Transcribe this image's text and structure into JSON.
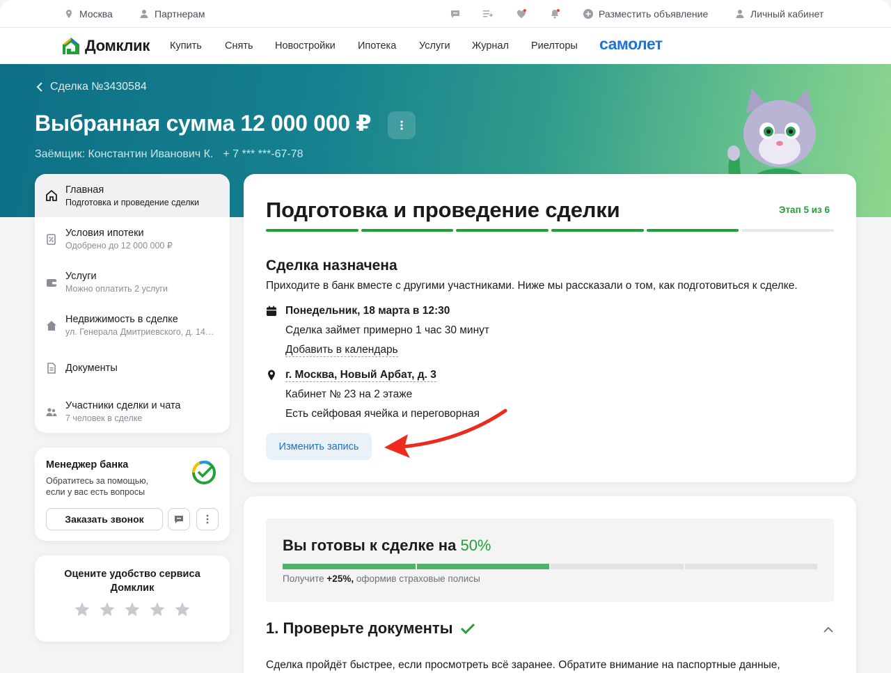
{
  "topbar": {
    "city": "Москва",
    "partners": "Партнерам",
    "post_ad": "Разместить объявление",
    "cabinet": "Личный кабинет"
  },
  "nav": {
    "logo": "Домклик",
    "links": [
      "Купить",
      "Снять",
      "Новостройки",
      "Ипотека",
      "Услуги",
      "Журнал",
      "Риелторы"
    ],
    "partner_brand": "самолет",
    "partner_color": "#1e73d8"
  },
  "hero": {
    "breadcrumb": "Сделка №3430584",
    "title": "Выбранная сумма 12 000 000 ₽",
    "borrower": "Заёмщик: Константин Иванович К.",
    "phone": "+ 7 *** ***-67-78"
  },
  "sidebar": {
    "items": [
      {
        "label": "Главная",
        "sub": "Подготовка и проведение сделки",
        "icon": "home-icon"
      },
      {
        "label": "Условия ипотеки",
        "sub": "Одобрено до 12 000 000 ₽",
        "icon": "percent-doc-icon"
      },
      {
        "label": "Услуги",
        "sub": "Можно оплатить 2 услуги",
        "icon": "wallet-icon"
      },
      {
        "label": "Недвижимость в сделке",
        "sub": "ул. Генерала Дмитриевского, д. 14…",
        "icon": "house-icon"
      },
      {
        "label": "Документы",
        "sub": "",
        "icon": "document-icon"
      },
      {
        "label": "Участники сделки и чата",
        "sub": "7 человек в сделке",
        "icon": "people-icon"
      }
    ]
  },
  "manager": {
    "title": "Менеджер банка",
    "text_line1": "Обратитесь за помощью,",
    "text_line2": "если у вас есть вопросы",
    "call_button": "Заказать звонок"
  },
  "rating": {
    "title_line1": "Оцените удобство сервиса",
    "title_line2": "Домклик",
    "stars_total": 5,
    "stars_selected": 0
  },
  "deal": {
    "title": "Подготовка и проведение сделки",
    "stage": "Этап 5 из 6",
    "stages_total": 6,
    "stages_done": 5,
    "section_title": "Сделка назначена",
    "section_desc": "Приходите в банк вместе с другими участниками. Ниже мы рассказали о том, как подготовиться к сделке.",
    "datetime": "Понедельник, 18 марта в 12:30",
    "duration": "Сделка займет примерно 1 час 30 минут",
    "add_calendar": "Добавить в календарь",
    "address": "г. Москва, Новый Арбат, д. 3",
    "office": "Кабинет № 23 на 2 этаже",
    "facilities": "Есть сейфовая ячейка и переговорная",
    "change_button": "Изменить запись",
    "accent": "#21a038"
  },
  "readiness": {
    "title_prefix": "Вы готовы к сделке на",
    "percent": "50%",
    "segments_total": 4,
    "segments_done": 2,
    "hint_prefix": "Получите",
    "hint_bonus": "+25%,",
    "hint_suffix": "оформив страховые полисы",
    "check_title": "1. Проверьте документы",
    "check_desc": "Сделка пройдёт быстрее, если просмотреть всё заранее. Обратите внимание на паспортные данные,"
  }
}
